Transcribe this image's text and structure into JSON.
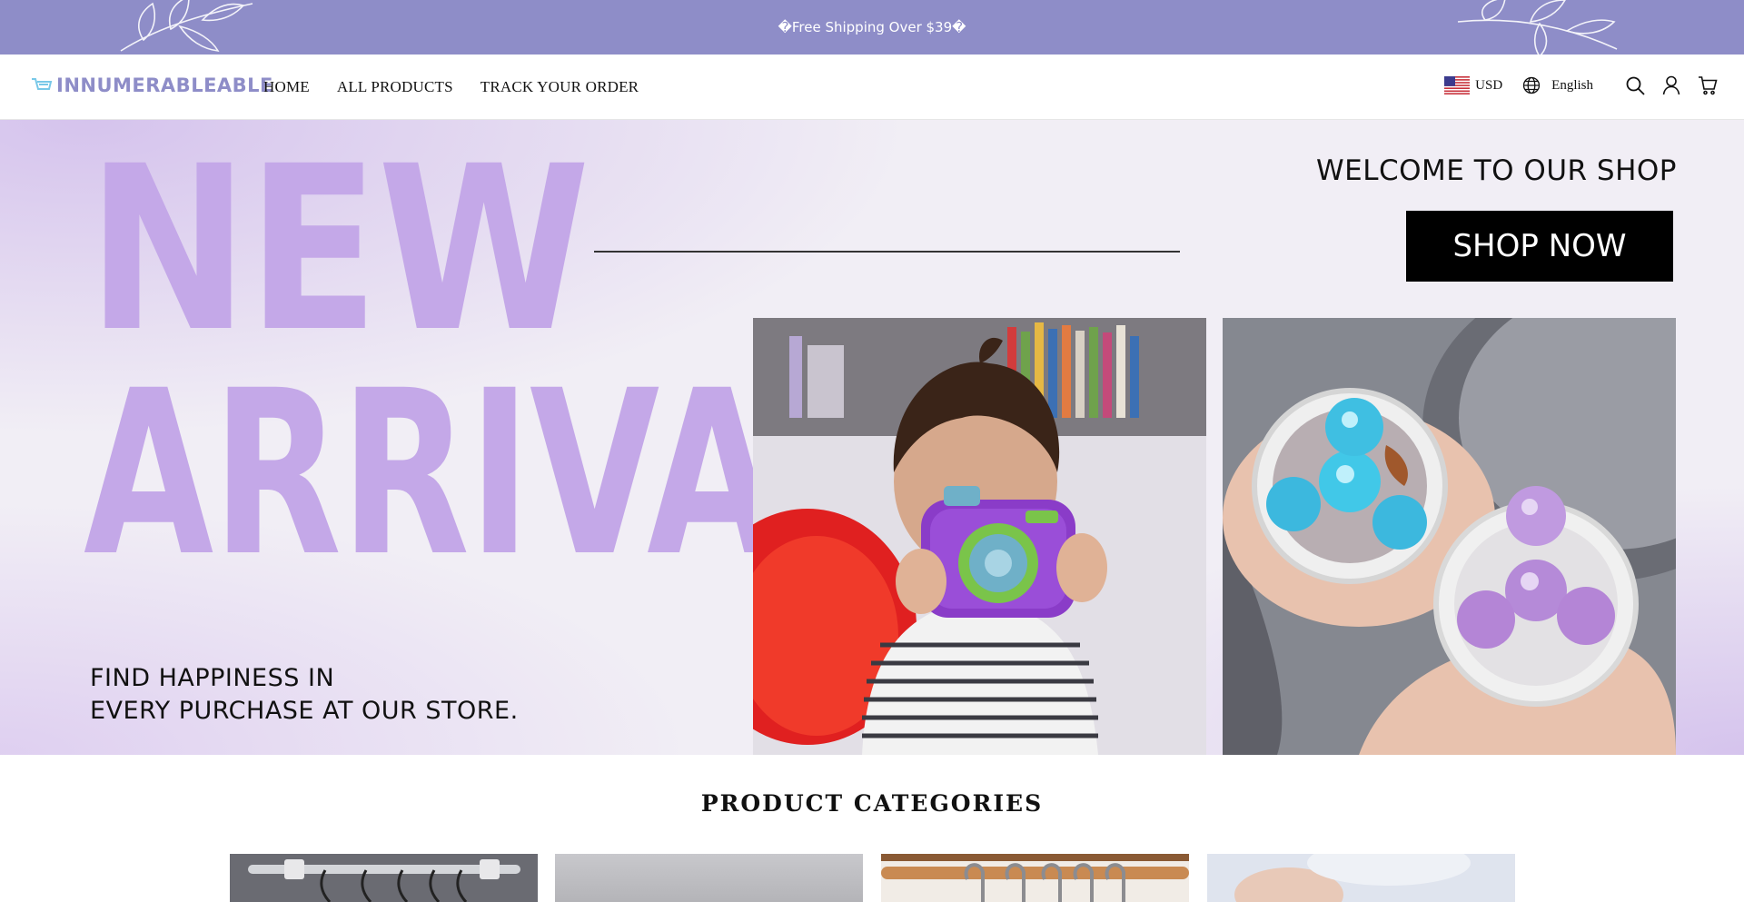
{
  "announcement": {
    "text": "�Free Shipping Over $39�"
  },
  "header": {
    "logo_text": "INNUMERABLEABLE",
    "nav": [
      {
        "label": "HOME"
      },
      {
        "label": "ALL PRODUCTS"
      },
      {
        "label": "TRACK YOUR ORDER"
      }
    ],
    "currency": "USD",
    "language": "English",
    "icons": [
      "us-flag-icon",
      "globe-icon",
      "search-icon",
      "account-icon",
      "cart-icon"
    ]
  },
  "hero": {
    "headline_line1": "NEW",
    "headline_line2": "ARRIVALS",
    "welcome": "WELCOME TO OUR SHOP",
    "cta_label": "SHOP NOW",
    "tagline_line1": "FIND HAPPINESS IN",
    "tagline_line2": "EVERY PURCHASE AT OUR STORE."
  },
  "categories": {
    "title": "PRODUCT CATEGORIES",
    "cards": [
      {
        "image": "curtain-rod-photo"
      },
      {
        "image": "gray-product-photo"
      },
      {
        "image": "wooden-hanger-rail-photo"
      },
      {
        "image": "baby-product-photo"
      }
    ]
  },
  "colors": {
    "brand_lavender": "#8e8dc8",
    "headline_purple": "#c4a8e8",
    "cta_background": "#000000"
  }
}
